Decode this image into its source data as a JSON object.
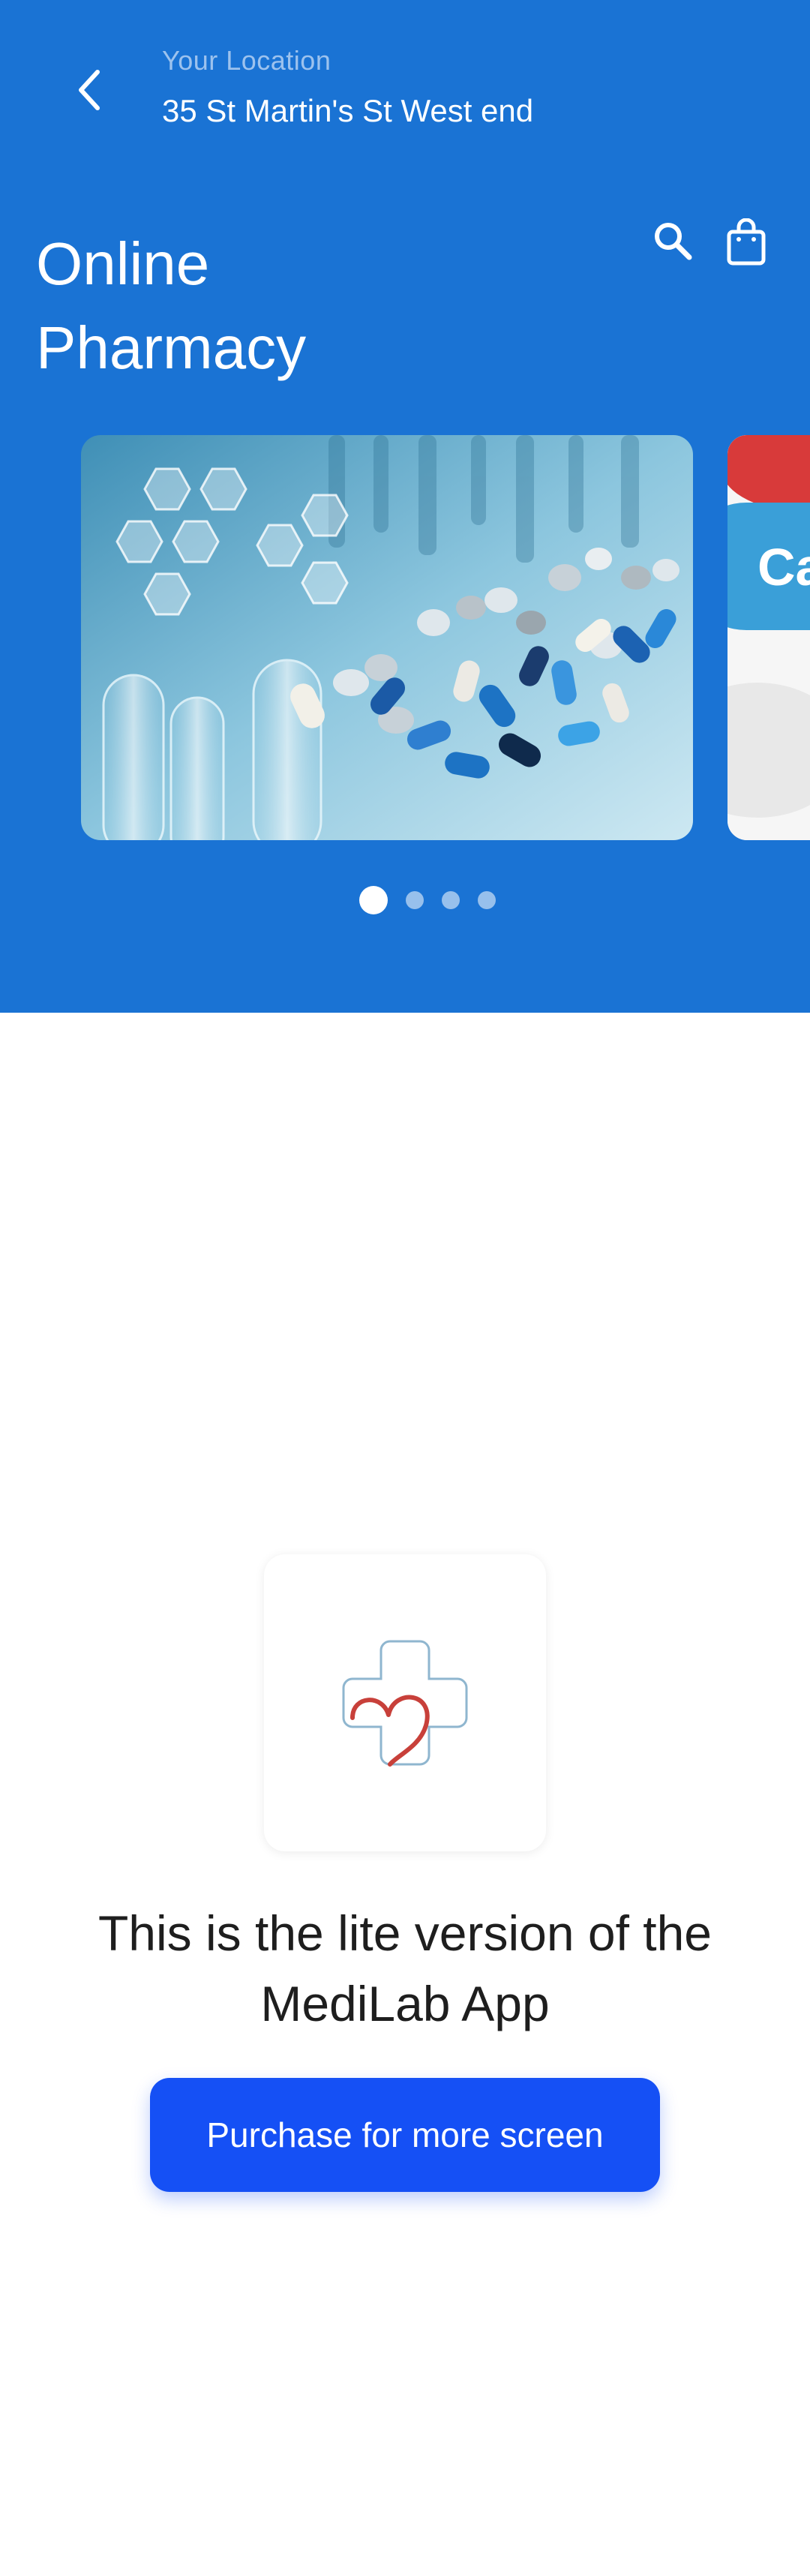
{
  "header": {
    "location_label": "Your Location",
    "location_value": "35 St Martin's St West end",
    "title": "Online Pharmacy",
    "back_icon": "chevron-left-icon",
    "search_icon": "search-icon",
    "cart_icon": "shopping-bag-icon"
  },
  "carousel": {
    "slides": [
      {
        "image": "pills-and-lab-glassware-photo"
      },
      {
        "image": "capsule-closeup-photo",
        "partial_text": "Ca"
      }
    ],
    "active_index": 0,
    "total_dots": 4
  },
  "lite_notice": {
    "logo": "medical-cross-heart-logo",
    "message": "This is the lite version of the MediLab App",
    "button_label": "Purchase for more screen"
  },
  "colors": {
    "header_bg": "#1a73d4",
    "button_bg": "#1550f5",
    "heart": "#c8403a",
    "cross_outline": "#8fb6cf"
  }
}
